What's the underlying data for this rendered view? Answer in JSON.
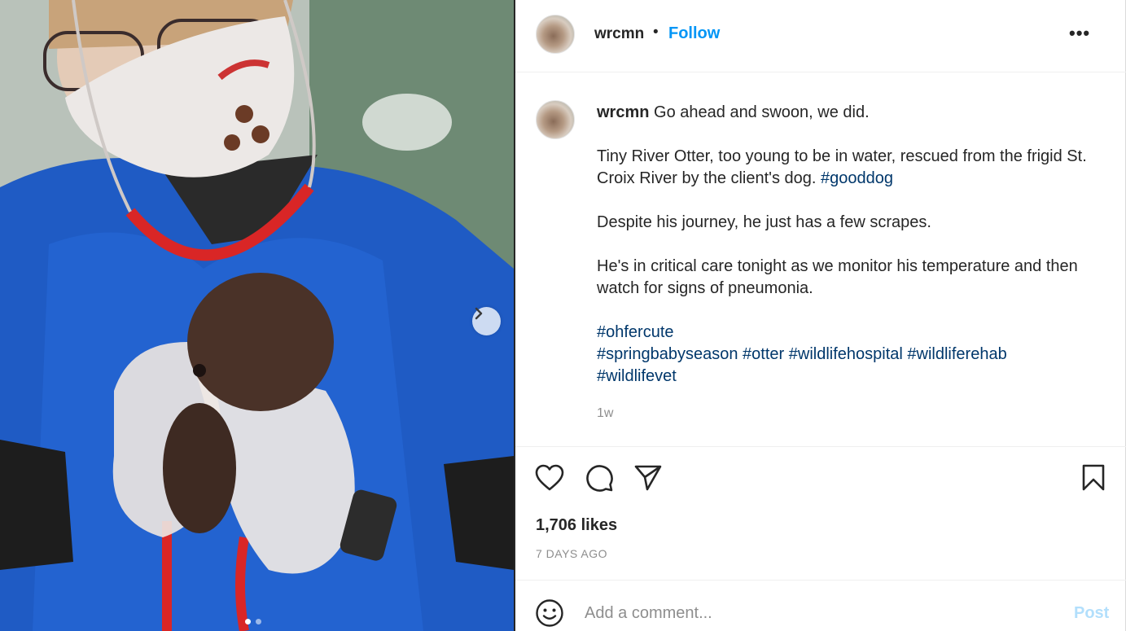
{
  "post": {
    "media": {
      "description_icon": "photo",
      "next_icon": "chevron-right-icon",
      "carousel": {
        "count": 2,
        "active_index": 0
      }
    },
    "header": {
      "username": "wrcmn",
      "separator": "•",
      "follow_label": "Follow",
      "more_label": "•••"
    },
    "caption": {
      "username": "wrcmn",
      "first_line": "Go ahead and swoon, we did.",
      "para2_text": "Tiny River Otter, too young to be in water, rescued from the frigid St. Croix River by the client's dog.",
      "para2_tag": "#gooddog",
      "para3": "Despite his journey, he just has a few scrapes.",
      "para4": "He's in critical care tonight as we monitor his temperature and then watch for signs of pneumonia.",
      "tags_line1": [
        "#ohfercute"
      ],
      "tags_line2": [
        "#springbabyseason",
        "#otter",
        "#wildlifehospital",
        "#wildliferehab"
      ],
      "tags_line3": [
        "#wildlifevet"
      ],
      "time_ago": "1w"
    },
    "actions": {
      "likes": "1,706 likes",
      "date": "7 DAYS AGO"
    },
    "comment": {
      "placeholder": "Add a comment...",
      "post_label": "Post"
    },
    "colors": {
      "accent": "#0095f6",
      "hashtag": "#00376b",
      "muted": "#8e8e8e",
      "post_disabled": "#b2dffc"
    }
  }
}
